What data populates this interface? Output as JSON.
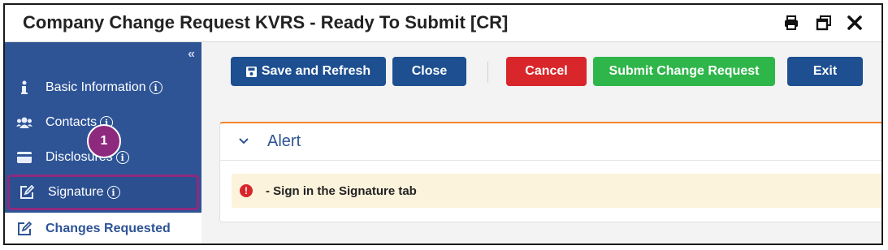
{
  "window": {
    "title": "Company Change Request KVRS - Ready To Submit [CR]",
    "icons": [
      "print-icon",
      "restore-window-icon",
      "close-icon"
    ]
  },
  "sidebar": {
    "collapse_glyph": "«",
    "info_glyph": "i",
    "items": [
      {
        "label": "Basic Information",
        "icon": "info-icon"
      },
      {
        "label": "Contacts",
        "icon": "users-icon"
      },
      {
        "label": "Disclosures",
        "icon": "card-icon"
      },
      {
        "label": "Signature",
        "icon": "edit-icon"
      },
      {
        "label": "Changes Requested",
        "icon": "edit-icon"
      }
    ]
  },
  "callout": {
    "number": "1"
  },
  "toolbar": {
    "save_label": "Save and Refresh",
    "close_label": "Close",
    "cancel_label": "Cancel",
    "submit_label": "Submit Change Request",
    "exit_label": "Exit"
  },
  "alert": {
    "title": "Alert",
    "message": "- Sign in the Signature tab",
    "error_glyph": "!"
  },
  "colors": {
    "sidebar": "#2e5496",
    "primary": "#1d4f91",
    "danger": "#d8262a",
    "success": "#2fb64a",
    "callout": "#8e2a7e",
    "alert_accent": "#f0862a",
    "alert_bg": "#fcf3dc"
  }
}
